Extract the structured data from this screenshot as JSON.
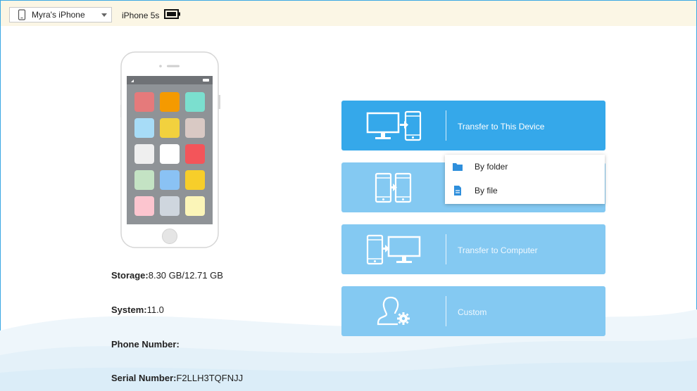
{
  "topbar": {
    "device_name": "Myra's iPhone",
    "device_model": "iPhone 5s"
  },
  "device_info": {
    "storage_label": "Storage:",
    "storage_value": "8.30 GB/12.71 GB",
    "system_label": "System:",
    "system_value": "11.0",
    "phone_label": "Phone Number:",
    "phone_value": "",
    "serial_label": "Serial Number:",
    "serial_value": "F2LLH3TQFNJJ"
  },
  "actions": {
    "transfer_to_device": "Transfer to This Device",
    "transfer_to_computer": "Transfer to Computer",
    "custom": "Custom"
  },
  "dropdown": {
    "by_folder": "By folder",
    "by_file": "By file"
  },
  "colors": {
    "primary": "#35a8ea",
    "secondary": "#84c9f2",
    "topbar": "#fbf6e5"
  },
  "app_icons": [
    "#e57a7b",
    "#f59a00",
    "#7bdfcf",
    "#a7dcf7",
    "#f2d13e",
    "#d9c9c4",
    "#efefef",
    "#ffffff",
    "#f3555a",
    "#c4e3c4",
    "#8ac2f4",
    "#f7ce2a",
    "#fcc5cf",
    "#cfd6de",
    "#fbf5b8"
  ]
}
